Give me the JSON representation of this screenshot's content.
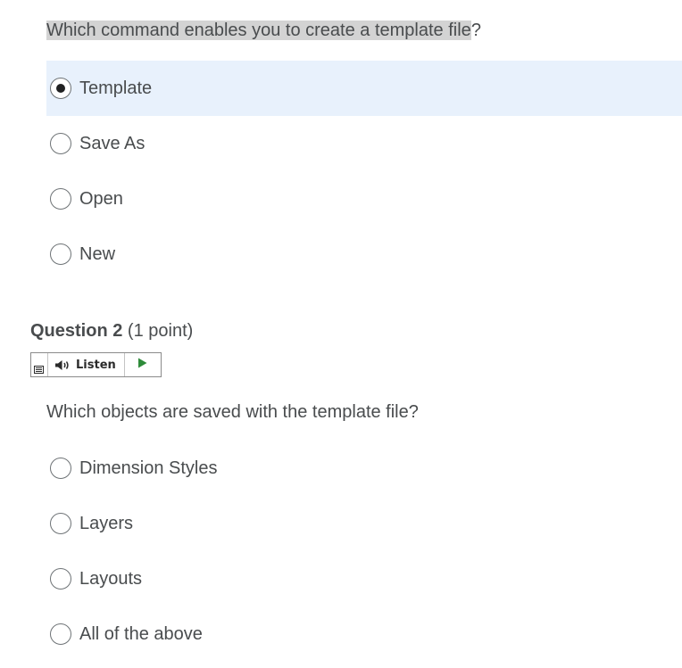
{
  "question1": {
    "text_highlighted": "Which command enables you to create a template file",
    "text_tail": "?",
    "options": [
      {
        "label": "Template",
        "selected": true
      },
      {
        "label": "Save As",
        "selected": false
      },
      {
        "label": "Open",
        "selected": false
      },
      {
        "label": "New",
        "selected": false
      }
    ]
  },
  "question2": {
    "number_label": "Question 2",
    "points_label": "(1 point)",
    "listen_label": "Listen",
    "text": "Which objects are saved with the template file?",
    "options": [
      {
        "label": "Dimension Styles",
        "selected": false
      },
      {
        "label": "Layers",
        "selected": false
      },
      {
        "label": "Layouts",
        "selected": false
      },
      {
        "label": "All of the above",
        "selected": false
      }
    ]
  },
  "colors": {
    "selected_bg": "#e8f1fc",
    "highlight_bg": "#d3d3d3",
    "text": "#494c4e",
    "play_green": "#2e8b3a"
  },
  "icons": {
    "listen": "speaker-icon",
    "play": "play-icon",
    "menu": "menu-icon"
  }
}
